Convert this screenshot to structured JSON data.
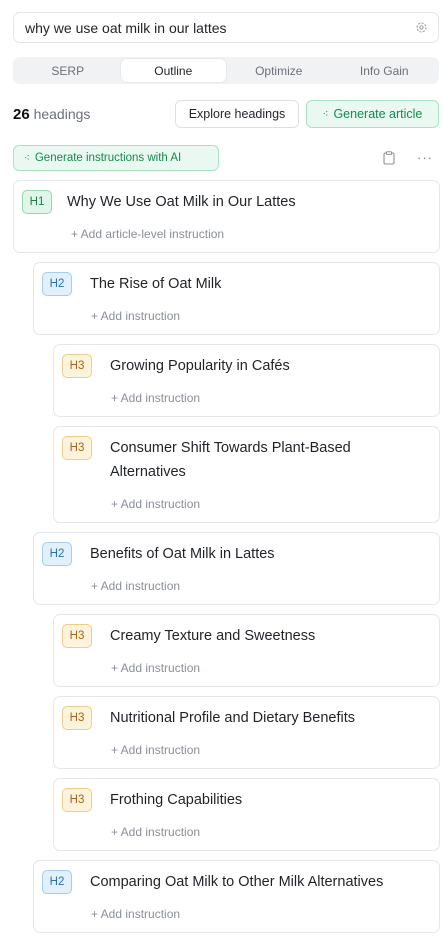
{
  "search": {
    "query": "why we use oat milk in our lattes"
  },
  "tabs": [
    {
      "label": "SERP"
    },
    {
      "label": "Outline"
    },
    {
      "label": "Optimize"
    },
    {
      "label": "Info Gain"
    }
  ],
  "toolbar": {
    "count": "26",
    "count_label": "headings",
    "explore_label": "Explore headings",
    "generate_label": "Generate article",
    "instructions_label": "Generate instructions with AI",
    "more_label": "···"
  },
  "outline": [
    {
      "level": "H1",
      "title": "Why We Use Oat Milk in Our Lattes",
      "add": "+ Add article-level instruction"
    },
    {
      "level": "H2",
      "title": "The Rise of Oat Milk",
      "add": "+ Add instruction"
    },
    {
      "level": "H3",
      "title": "Growing Popularity in Cafés",
      "add": "+ Add instruction"
    },
    {
      "level": "H3",
      "title": "Consumer Shift Towards Plant-Based Alternatives",
      "add": "+ Add instruction"
    },
    {
      "level": "H2",
      "title": "Benefits of Oat Milk in Lattes",
      "add": "+ Add instruction"
    },
    {
      "level": "H3",
      "title": "Creamy Texture and Sweetness",
      "add": "+ Add instruction"
    },
    {
      "level": "H3",
      "title": "Nutritional Profile and Dietary Benefits",
      "add": "+ Add instruction"
    },
    {
      "level": "H3",
      "title": "Frothing Capabilities",
      "add": "+ Add instruction"
    },
    {
      "level": "H2",
      "title": "Comparing Oat Milk to Other Milk Alternatives",
      "add": "+ Add instruction"
    }
  ],
  "colors": {
    "accent_green": "#178a4f",
    "h1_badge": "#dff6e8",
    "h2_badge": "#e2f0fb",
    "h3_badge": "#fdf3dc"
  }
}
